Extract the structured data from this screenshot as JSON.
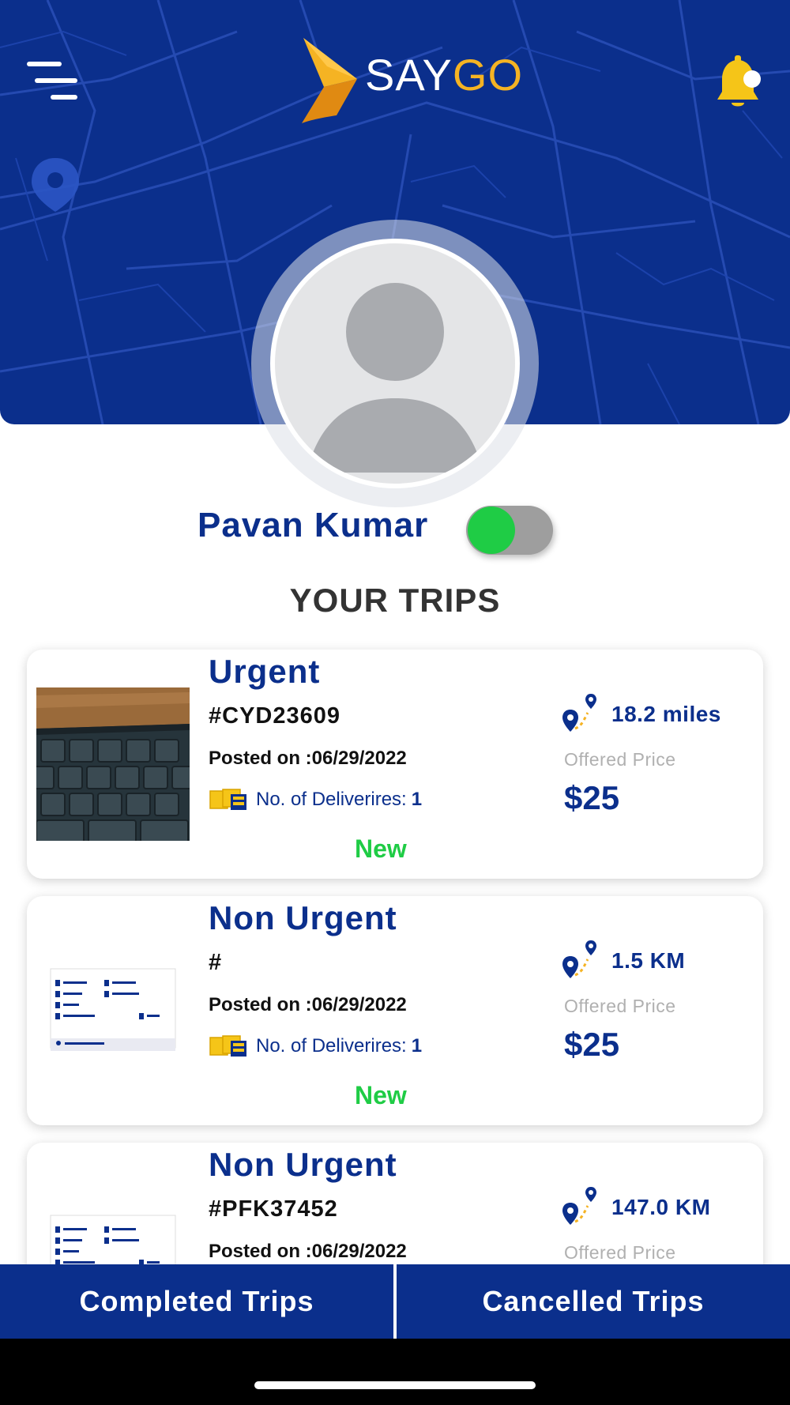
{
  "app": {
    "logo_say": "SAY",
    "logo_go": "GO"
  },
  "colors": {
    "brand_blue": "#0b2f8c",
    "brand_orange": "#f5a623",
    "status_green": "#1fcc45",
    "bell_yellow": "#f5c518"
  },
  "icons": {
    "menu": "menu-icon",
    "notifications": "bell-icon",
    "route": "route-pin-icon",
    "deliveries": "packages-icon"
  },
  "profile": {
    "name": "Pavan Kumar",
    "online_toggle": true
  },
  "section_title": "YOUR TRIPS",
  "trips": [
    {
      "urgency": "Urgent",
      "trip_id": "#CYD23609",
      "posted": "Posted on :06/29/2022",
      "deliveries_label": "No. of Deliverires:",
      "deliveries_count": "1",
      "distance": "18.2 miles",
      "offered_label": "Offered Price",
      "price": "$25",
      "status": "New"
    },
    {
      "urgency": "Non Urgent",
      "trip_id": "#",
      "posted": "Posted on :06/29/2022",
      "deliveries_label": "No. of Deliverires:",
      "deliveries_count": "1",
      "distance": "1.5 KM",
      "offered_label": "Offered Price",
      "price": "$25",
      "status": "New"
    },
    {
      "urgency": "Non Urgent",
      "trip_id": "#PFK37452",
      "posted": "Posted on :06/29/2022",
      "distance": "147.0 KM",
      "offered_label": "Offered Price"
    }
  ],
  "tabs": {
    "completed": "Completed Trips",
    "cancelled": "Cancelled Trips"
  }
}
